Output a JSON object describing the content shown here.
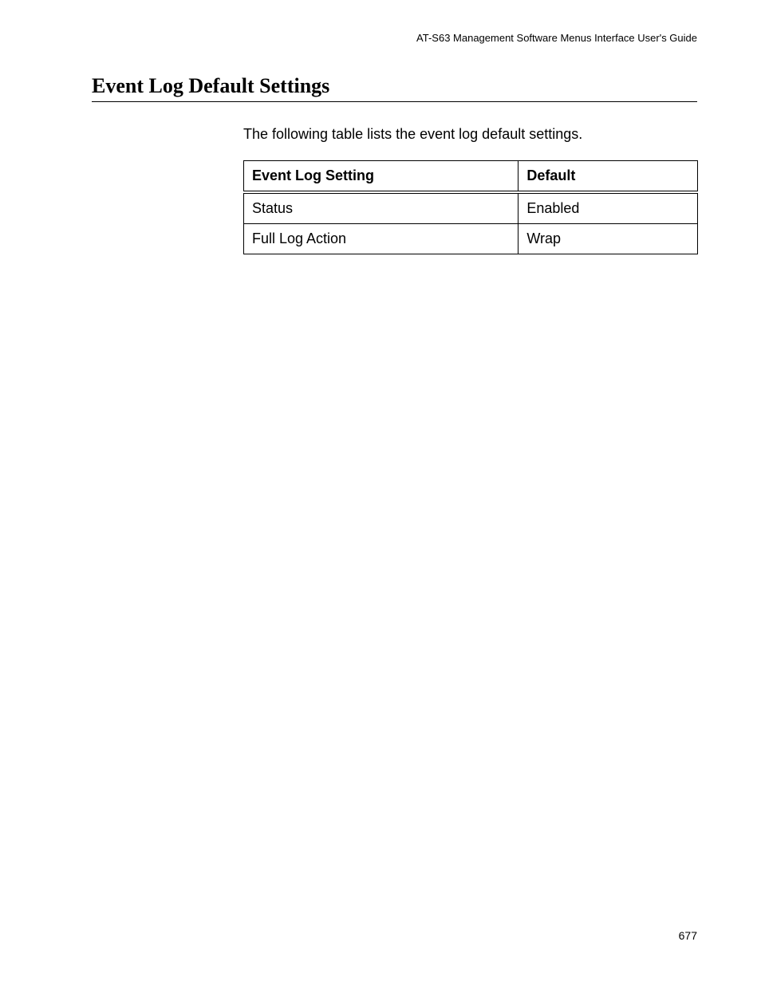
{
  "header": {
    "running_title": "AT-S63 Management Software Menus Interface User's Guide"
  },
  "section": {
    "title": "Event Log Default Settings",
    "intro": "The following table lists the event log default settings."
  },
  "table": {
    "headers": {
      "setting": "Event Log Setting",
      "default": "Default"
    },
    "rows": [
      {
        "setting": "Status",
        "default": "Enabled"
      },
      {
        "setting": "Full Log Action",
        "default": "Wrap"
      }
    ]
  },
  "footer": {
    "page_number": "677"
  }
}
